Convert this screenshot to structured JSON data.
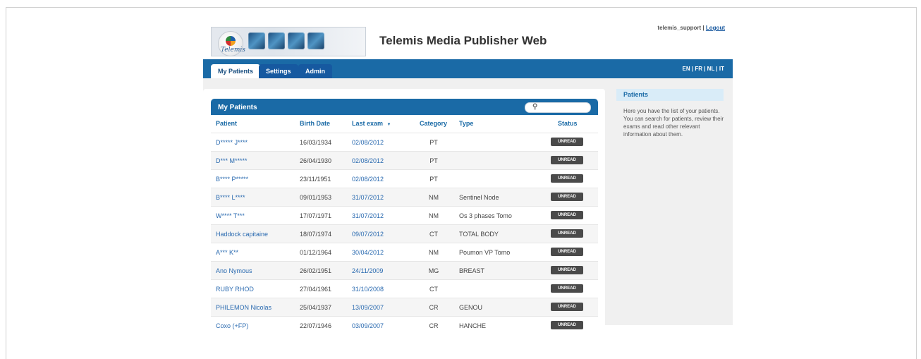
{
  "app": {
    "logo_text": "Telemis",
    "title": "Telemis Media Publisher Web"
  },
  "user": {
    "name": "telemis_support",
    "separator": " | ",
    "logout": "Logout"
  },
  "nav": {
    "tabs": [
      {
        "label": "My Patients",
        "active": true
      },
      {
        "label": "Settings",
        "active": false
      },
      {
        "label": "Admin",
        "active": false
      }
    ],
    "languages": "EN | FR | NL | IT"
  },
  "grid": {
    "title": "My Patients",
    "search": {
      "placeholder": "",
      "icon": "search-icon"
    },
    "columns": {
      "patient": "Patient",
      "birth_date": "Birth Date",
      "last_exam": "Last exam",
      "sort_indicator": "▼",
      "category": "Category",
      "type": "Type",
      "status": "Status"
    },
    "rows": [
      {
        "patient": "D***** J****",
        "birth": "16/03/1934",
        "exam": "02/08/2012",
        "category": "PT",
        "type": "",
        "status": "UNREAD"
      },
      {
        "patient": "D*** M*****",
        "birth": "26/04/1930",
        "exam": "02/08/2012",
        "category": "PT",
        "type": "",
        "status": "UNREAD"
      },
      {
        "patient": "B**** P*****",
        "birth": "23/11/1951",
        "exam": "02/08/2012",
        "category": "PT",
        "type": "",
        "status": "UNREAD"
      },
      {
        "patient": "B**** L****",
        "birth": "09/01/1953",
        "exam": "31/07/2012",
        "category": "NM",
        "type": "Sentinel Node",
        "status": "UNREAD"
      },
      {
        "patient": "W**** T***",
        "birth": "17/07/1971",
        "exam": "31/07/2012",
        "category": "NM",
        "type": "Os 3 phases Tomo",
        "status": "UNREAD"
      },
      {
        "patient": "Haddock capitaine",
        "birth": "18/07/1974",
        "exam": "09/07/2012",
        "category": "CT",
        "type": "TOTAL BODY",
        "status": "UNREAD"
      },
      {
        "patient": "A*** K**",
        "birth": "01/12/1964",
        "exam": "30/04/2012",
        "category": "NM",
        "type": "Poumon VP Tomo",
        "status": "UNREAD"
      },
      {
        "patient": "Ano Nymous",
        "birth": "26/02/1951",
        "exam": "24/11/2009",
        "category": "MG",
        "type": "BREAST",
        "status": "UNREAD"
      },
      {
        "patient": "RUBY RHOD",
        "birth": "27/04/1961",
        "exam": "31/10/2008",
        "category": "CT",
        "type": "",
        "status": "UNREAD"
      },
      {
        "patient": "PHILEMON Nicolas",
        "birth": "25/04/1937",
        "exam": "13/09/2007",
        "category": "CR",
        "type": "GENOU",
        "status": "UNREAD"
      },
      {
        "patient": "Coxo (+FP)",
        "birth": "22/07/1946",
        "exam": "03/09/2007",
        "category": "CR",
        "type": "HANCHE",
        "status": "UNREAD"
      }
    ]
  },
  "sidebar": {
    "title": "Patients",
    "text": "Here you have the list of your patients. You can search for patients, review their exams and read other relevant information about them."
  }
}
